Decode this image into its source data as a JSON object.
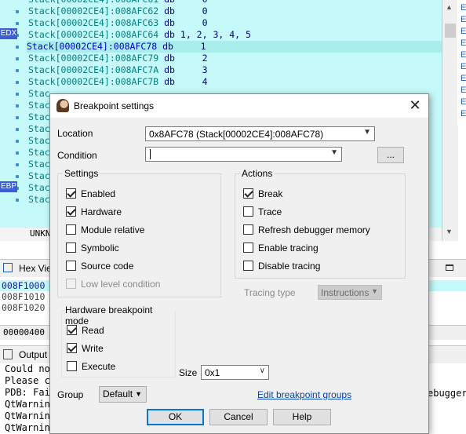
{
  "disasm": {
    "lines": [
      {
        "seg": "Stack[00002CE4]:008AFC61",
        "op": "db",
        "arg": "    0"
      },
      {
        "seg": "Stack[00002CE4]:008AFC62",
        "op": "db",
        "arg": "    0"
      },
      {
        "seg": "Stack[00002CE4]:008AFC63",
        "op": "db",
        "arg": "    0"
      },
      {
        "seg": "Stack[00002CE4]:008AFC64",
        "op": "db",
        "arg": "1, 2, 3, 4, 5"
      },
      {
        "seg": "Stack[00002CE4]:008AFC78",
        "op": "db",
        "arg": "    1"
      },
      {
        "seg": "Stack[00002CE4]:008AFC79",
        "op": "db",
        "arg": "    2"
      },
      {
        "seg": "Stack[00002CE4]:008AFC7A",
        "op": "db",
        "arg": "    3"
      },
      {
        "seg": "Stack[00002CE4]:008AFC7B",
        "op": "db",
        "arg": "    4"
      },
      {
        "seg": "Stac",
        "op": "",
        "arg": ""
      },
      {
        "seg": "Stac",
        "op": "",
        "arg": ""
      },
      {
        "seg": "Stac",
        "op": "",
        "arg": ""
      },
      {
        "seg": "Stac",
        "op": "",
        "arg": ""
      },
      {
        "seg": "Stac",
        "op": "",
        "arg": ""
      },
      {
        "seg": "Stac",
        "op": "",
        "arg": ""
      },
      {
        "seg": "Stac",
        "op": "",
        "arg": ""
      },
      {
        "seg": "Stac",
        "op": "",
        "arg": ""
      },
      {
        "seg": "Stac",
        "op": "",
        "arg": ""
      },
      {
        "seg": "Stac",
        "op": "",
        "arg": ""
      }
    ],
    "reg_edx": "EDX",
    "reg_ebp": "EBP",
    "unk_text": "UNKN"
  },
  "right_pane": {
    "letter": "E"
  },
  "hex_view": {
    "title": "Hex View",
    "rows": [
      "008F1000",
      "008F1010",
      "008F1020"
    ],
    "status": "00000400"
  },
  "output": {
    "title": "Output",
    "lines": [
      "Could no",
      "Please c",
      "PDB: Fai",
      "QtWarnin",
      "QtWarnin",
      "QtWarnin"
    ],
    "right_text": "ebugger"
  },
  "dialog": {
    "title": "Breakpoint settings",
    "location_label": "Location",
    "location_value": "0x8AFC78 (Stack[00002CE4]:008AFC78)",
    "condition_label": "Condition",
    "condition_value": "",
    "ellipsis_label": "...",
    "settings_title": "Settings",
    "settings": [
      {
        "label": "Enabled",
        "checked": true,
        "disabled": false
      },
      {
        "label": "Hardware",
        "checked": true,
        "disabled": false
      },
      {
        "label": "Module relative",
        "checked": false,
        "disabled": false
      },
      {
        "label": "Symbolic",
        "checked": false,
        "disabled": false
      },
      {
        "label": "Source code",
        "checked": false,
        "disabled": false
      },
      {
        "label": "Low level condition",
        "checked": false,
        "disabled": true
      }
    ],
    "actions_title": "Actions",
    "actions": [
      {
        "label": "Break",
        "checked": true
      },
      {
        "label": "Trace",
        "checked": false
      },
      {
        "label": "Refresh debugger memory",
        "checked": false
      },
      {
        "label": "Enable tracing",
        "checked": false
      },
      {
        "label": "Disable tracing",
        "checked": false
      }
    ],
    "tracing_type_label": "Tracing type",
    "tracing_type_value": "Instructions",
    "hw_title": "Hardware breakpoint mode",
    "hw_modes": [
      {
        "label": "Read",
        "checked": true
      },
      {
        "label": "Write",
        "checked": true
      },
      {
        "label": "Execute",
        "checked": false
      }
    ],
    "size_label": "Size",
    "size_value": "0x1",
    "group_label": "Group",
    "group_value": "Default",
    "edit_groups_link": "Edit breakpoint groups",
    "ok_label": "OK",
    "cancel_label": "Cancel",
    "help_label": "Help"
  }
}
